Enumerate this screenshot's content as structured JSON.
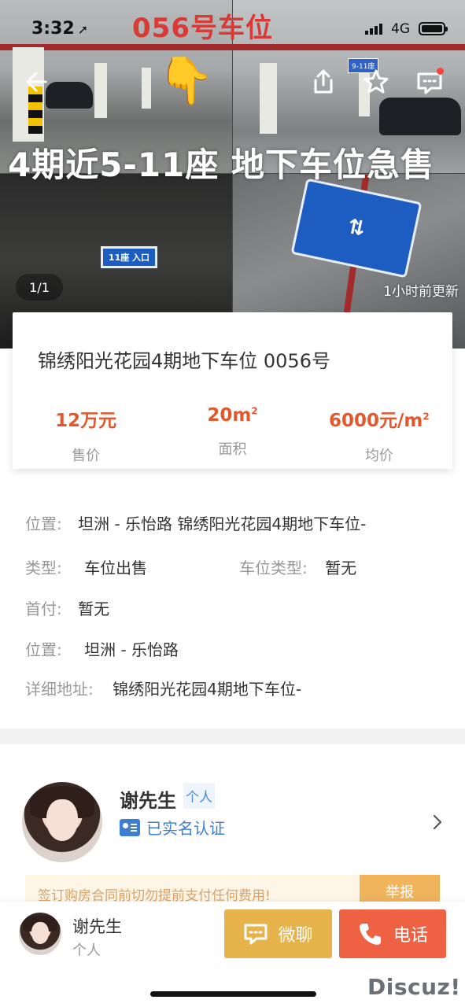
{
  "status_bar": {
    "time": "3:32",
    "network": "4G"
  },
  "hero": {
    "overlay_title": "056号车位",
    "overlay_banner": "4期近5-11座 地下车位急售",
    "sign_small_q2": "9-11座",
    "sign_small_q3": "11座 入口",
    "image_counter": "1/1",
    "updated_text": "1小时前更新"
  },
  "listing": {
    "title": "锦绣阳光花园4期地下车位 0056号",
    "stats": [
      {
        "value": "12万元",
        "label": "售价"
      },
      {
        "value": "20m",
        "value_sup": "2",
        "label": "面积"
      },
      {
        "value": "6000元/m",
        "value_sup": "2",
        "label": "均价"
      }
    ]
  },
  "details": {
    "location_label": "位置:",
    "location_value": "坦洲 - 乐怡路 锦绣阳光花园4期地下车位-",
    "type_label": "类型:",
    "type_value": "车位出售",
    "space_type_label": "车位类型:",
    "space_type_value": "暂无",
    "down_payment_label": "首付:",
    "down_payment_value": "暂无",
    "location2_label": "位置:",
    "location2_value": "坦洲 - 乐怡路",
    "address_label": "详细地址:",
    "address_value": "锦绣阳光花园4期地下车位-"
  },
  "agent": {
    "name": "谢先生",
    "tag": "个人",
    "verified_text": "已实名认证"
  },
  "notice": {
    "text": "签订购房合同前切勿提前支付任何费用!",
    "report_label": "举报"
  },
  "bottom_bar": {
    "name": "谢先生",
    "type": "个人",
    "chat_label": "微聊",
    "call_label": "电话"
  },
  "watermark": "Discuz!",
  "colors": {
    "accent_red": "#e3572c",
    "chat_yellow": "#e6b24a",
    "call_red": "#ee6142",
    "verified_blue": "#3d7ed2"
  }
}
